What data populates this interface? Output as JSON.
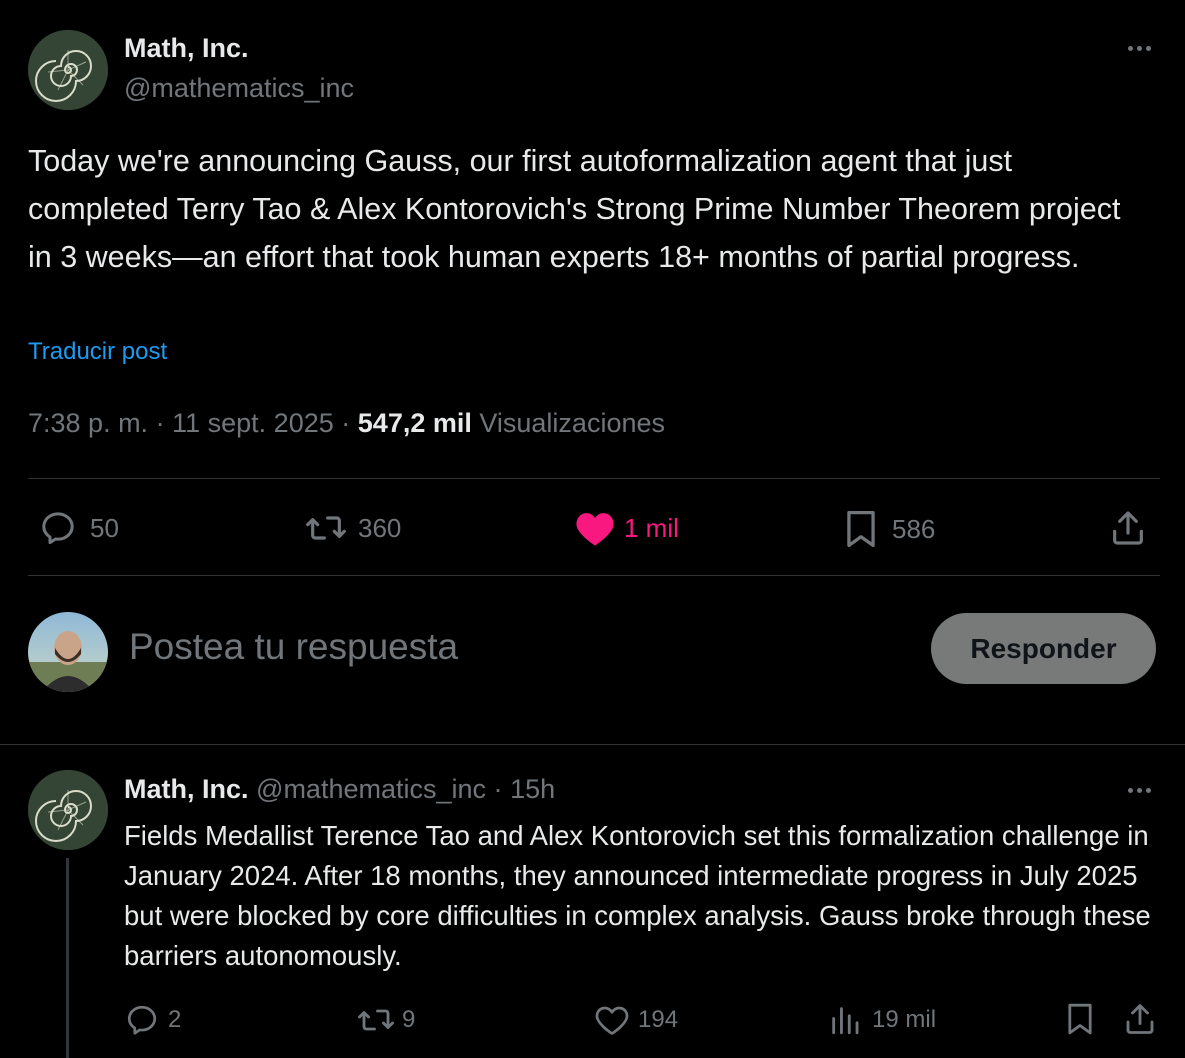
{
  "main_post": {
    "author_name": "Math, Inc.",
    "author_handle": "@mathematics_inc",
    "text": "Today we're announcing Gauss, our first autoformalization agent that just completed Terry Tao & Alex Kontorovich's Strong Prime Number Theorem project in 3 weeks—an effort that took human experts 18+ months of partial progress.",
    "translate_label": "Traducir post",
    "time": "7:38 p. m.",
    "date": "11 sept. 2025",
    "separator": "·",
    "views_count": "547,2 mil",
    "views_label": "Visualizaciones",
    "actions": {
      "replies": "50",
      "reposts": "360",
      "likes": "1 mil",
      "bookmarks": "586"
    }
  },
  "composer": {
    "placeholder": "Postea tu respuesta",
    "button_label": "Responder"
  },
  "reply_post": {
    "author_name": "Math, Inc.",
    "author_handle": "@mathematics_inc",
    "separator": "·",
    "time_ago": "15h",
    "text": "Fields Medallist Terence Tao and Alex Kontorovich set this formalization challenge in January 2024. After 18 months, they announced intermediate progress in July 2025 but were blocked by core difficulties in complex analysis. Gauss broke through these barriers autonomously.",
    "actions": {
      "replies": "2",
      "reposts": "9",
      "likes": "194",
      "views": "19 mil"
    }
  },
  "colors": {
    "background": "#000000",
    "text": "#e7e9ea",
    "muted": "#71767b",
    "link": "#1d9bf0",
    "like": "#f91880",
    "divider": "#2f3336",
    "button_bg": "#787a7a"
  }
}
